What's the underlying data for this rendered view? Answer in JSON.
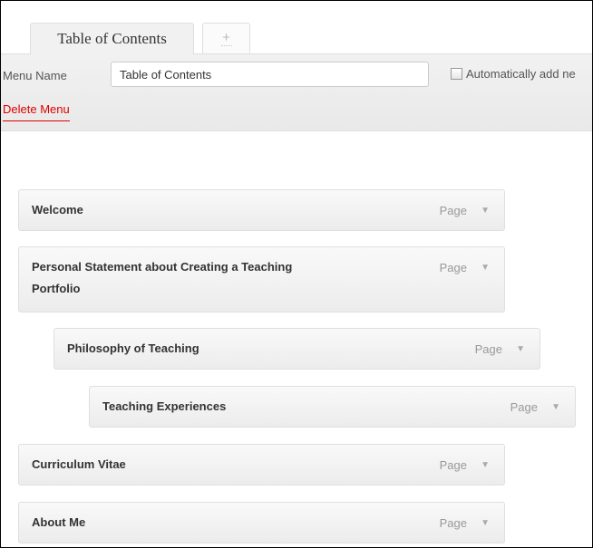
{
  "tabs": [
    {
      "label": "Table of Contents"
    },
    {
      "label": "+"
    }
  ],
  "header": {
    "menu_name_label": "Menu Name",
    "menu_name_value": "Table of Contents",
    "auto_add_label": "Automatically add ne",
    "delete_label": "Delete Menu"
  },
  "items": [
    {
      "title": "Welcome",
      "type": "Page",
      "toggle": "▼",
      "depth": 0
    },
    {
      "title": "Personal Statement about Creating a Teaching Portfolio",
      "type": "Page",
      "toggle": "▼",
      "depth": 0
    },
    {
      "title": "Philosophy of Teaching",
      "type": "Page",
      "toggle": "▼",
      "depth": 1
    },
    {
      "title": "Teaching Experiences",
      "type": "Page",
      "toggle": "▼",
      "depth": 2
    },
    {
      "title": "Curriculum Vitae",
      "type": "Page",
      "toggle": "▼",
      "depth": 0
    },
    {
      "title": "About Me",
      "type": "Page",
      "toggle": "▼",
      "depth": 0
    }
  ],
  "colors": {
    "delete_link": "#e00000",
    "header_bg": "#ececec",
    "item_bg": "#f1f1f1"
  }
}
